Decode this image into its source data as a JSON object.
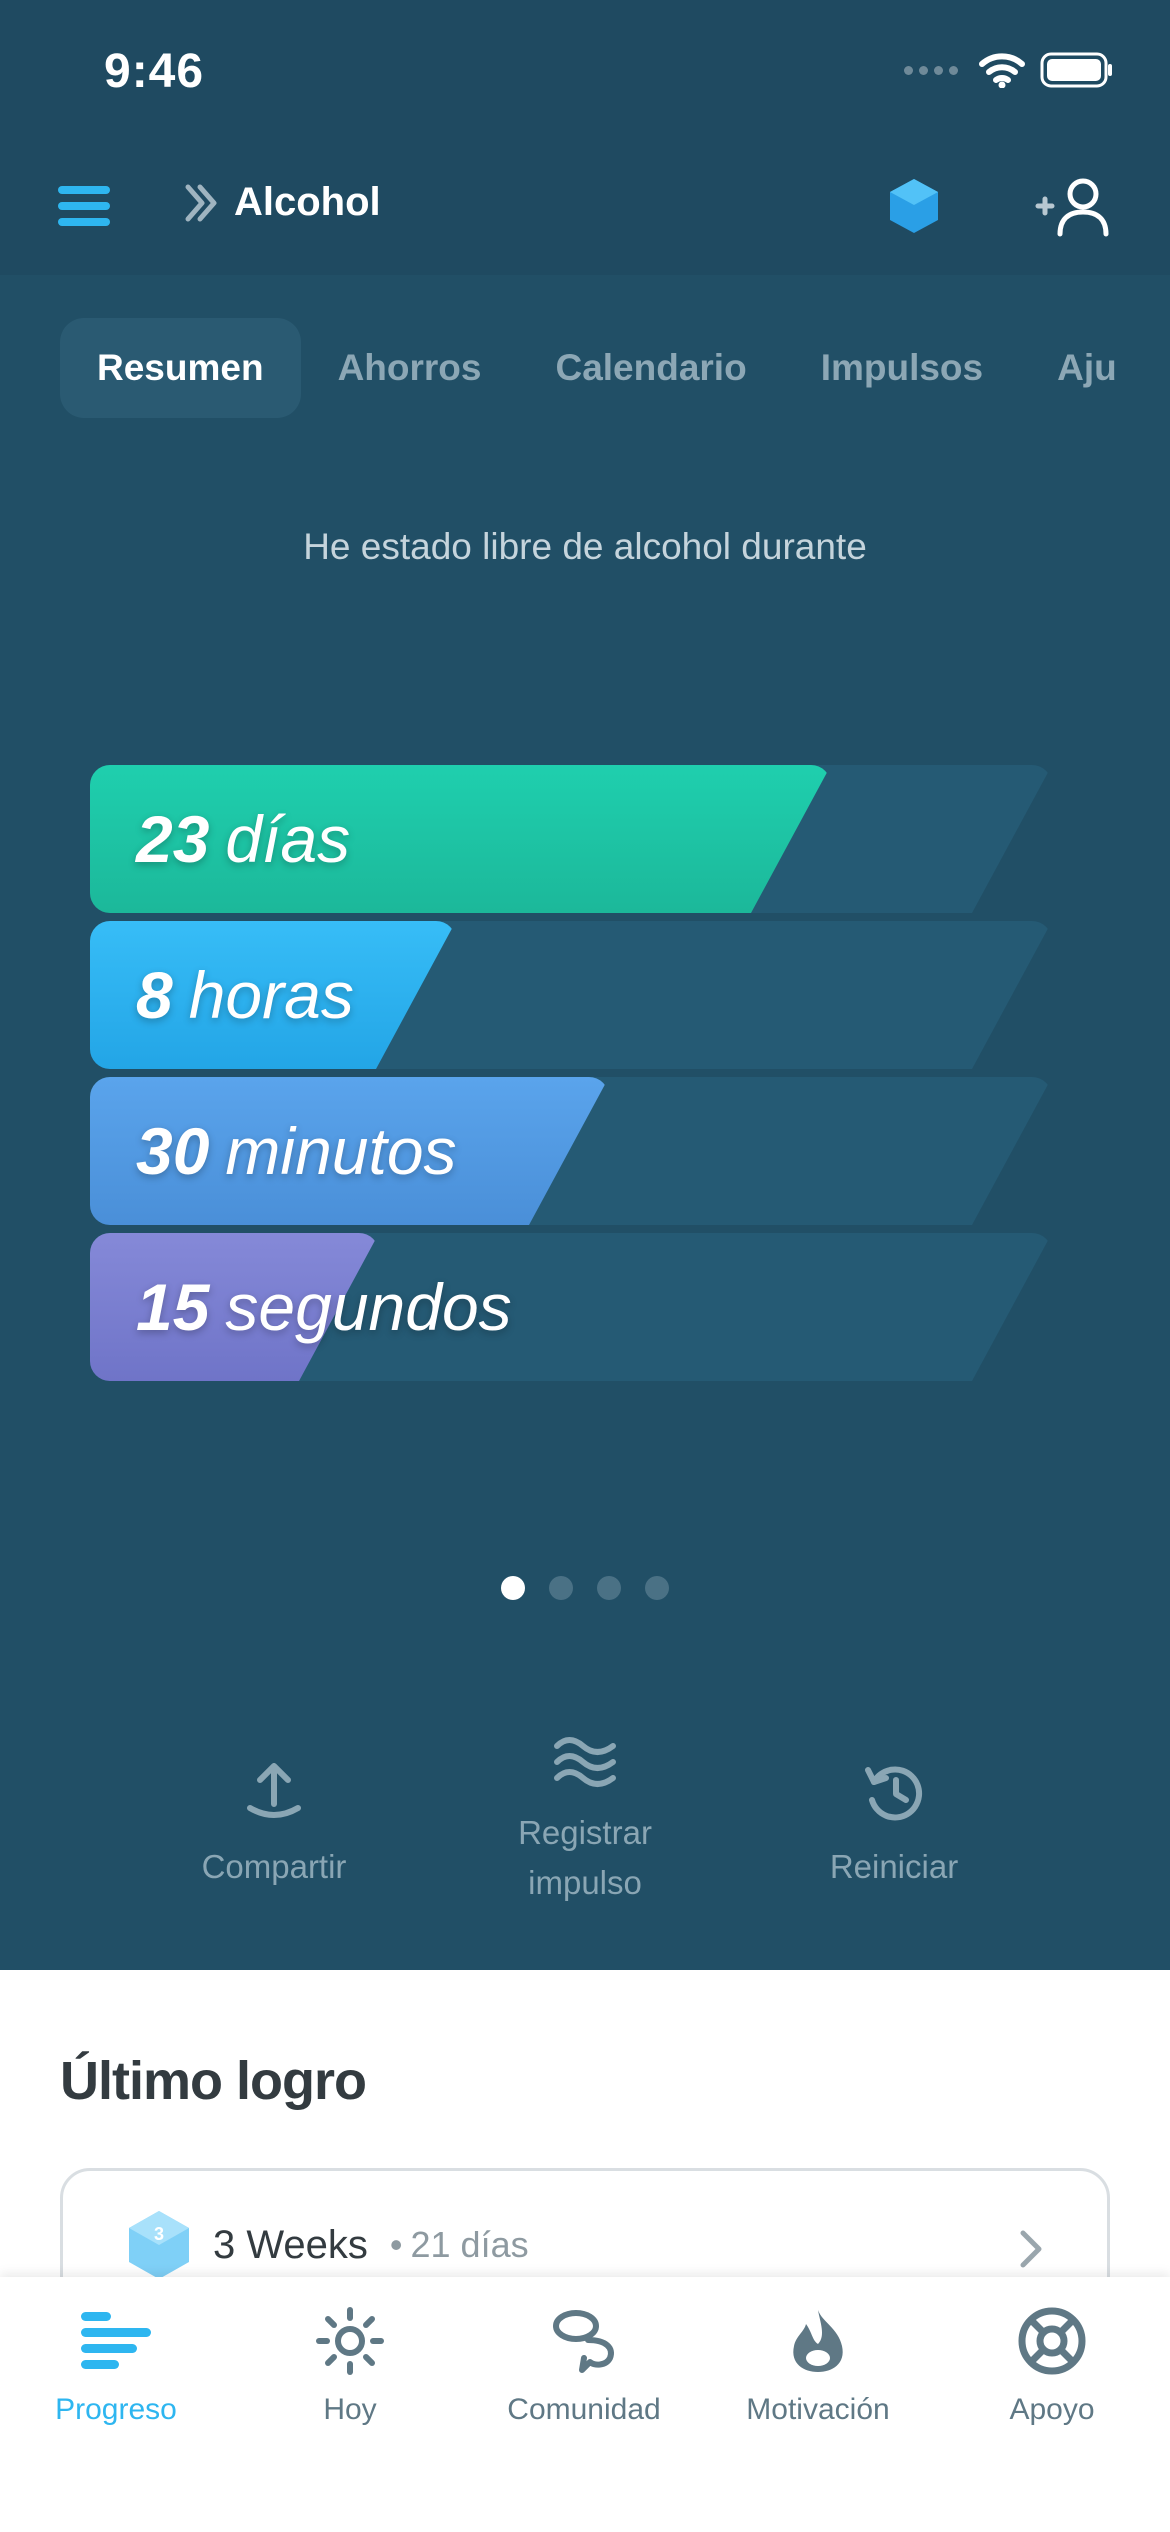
{
  "status_bar": {
    "time": "9:46"
  },
  "header": {
    "title": "Alcohol"
  },
  "tabs": [
    {
      "label": "Resumen",
      "active": true
    },
    {
      "label": "Ahorros",
      "active": false
    },
    {
      "label": "Calendario",
      "active": false
    },
    {
      "label": "Impulsos",
      "active": false
    },
    {
      "label": "Aju",
      "active": false
    }
  ],
  "summary": {
    "intro": "He estado libre de alcohol durante",
    "bars": [
      {
        "value": "23",
        "unit": "días",
        "fraction": 0.77,
        "color_start": "#1fcfae",
        "color_end": "#1cb89a"
      },
      {
        "value": "8",
        "unit": "horas",
        "fraction": 0.38,
        "color_start": "#37bdf7",
        "color_end": "#23a5e6"
      },
      {
        "value": "30",
        "unit": "minutos",
        "fraction": 0.54,
        "color_start": "#5aa4ec",
        "color_end": "#4a8fd8"
      },
      {
        "value": "15",
        "unit": "segundos",
        "fraction": 0.3,
        "color_start": "#8589d8",
        "color_end": "#6f74c8"
      }
    ],
    "pager": {
      "count": 4,
      "active": 0
    }
  },
  "actions": [
    {
      "label": "Compartir",
      "icon": "share-icon"
    },
    {
      "label": "Registrar impulso",
      "icon": "waves-icon"
    },
    {
      "label": "Reiniciar",
      "icon": "history-icon"
    }
  ],
  "achievement": {
    "section_title": "Último logro",
    "badge_number": "3",
    "name": "3 Weeks",
    "separator": "•",
    "days": "21 días"
  },
  "bottom_nav": [
    {
      "label": "Progreso",
      "icon": "progress-icon",
      "active": true
    },
    {
      "label": "Hoy",
      "icon": "sun-icon",
      "active": false
    },
    {
      "label": "Comunidad",
      "icon": "community-icon",
      "active": false
    },
    {
      "label": "Motivación",
      "icon": "flame-icon",
      "active": false
    },
    {
      "label": "Apoyo",
      "icon": "lifebuoy-icon",
      "active": false
    }
  ],
  "colors": {
    "header_bg": "#1f4a61",
    "content_bg": "#214f66",
    "accent": "#2eb6f0"
  }
}
